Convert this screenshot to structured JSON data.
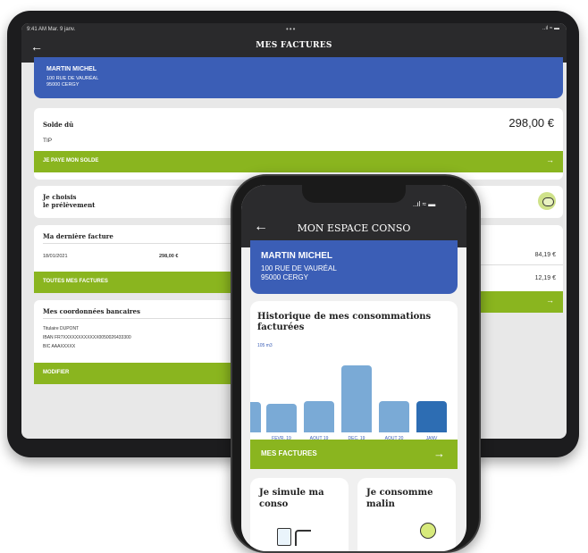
{
  "tablet": {
    "status_time": "9:41 AM  Mar. 9 janv.",
    "status_right": "..ıl ≈ ▬",
    "title": "MES FACTURES",
    "user": {
      "name": "MARTIN MICHEL",
      "address1": "100 RUE DE VAURÉAL",
      "address2": "95000 CERGY"
    },
    "balance": {
      "label": "Solde dû",
      "amount": "298,00 €",
      "mode": "TIP",
      "pay_button": "JE PAYE MON SOLDE"
    },
    "direct_debit": {
      "line1": "Je choisis",
      "line2": "le prélèvement"
    },
    "last_invoice": {
      "label": "Ma dernière facture",
      "date": "18/01/2021",
      "amount": "298,00 €",
      "all_button": "TOUTES MES FACTURES"
    },
    "right_amounts": [
      "84,19 €",
      "12,19 €"
    ],
    "bank": {
      "label": "Mes coordonnées bancaires",
      "holder_label": "Titulaire",
      "holder": "DUPONT",
      "iban_label": "IBAN",
      "iban": "FR7XXXXXXXXXXXX0050026433300",
      "bic_label": "BIC",
      "bic": "AAAXXXXX",
      "modify_button": "MODIFIER"
    }
  },
  "phone": {
    "status": "..ıl ≈ ▬",
    "title": "MON ESPACE CONSO",
    "user": {
      "name": "MARTIN MICHEL",
      "address1": "100 RUE DE VAURÉAL",
      "address2": "95000 CERGY"
    },
    "history_title": "Historique de mes consommations facturées",
    "invoices_button": "MES FACTURES",
    "tile1": "Je simule ma conso",
    "tile2": "Je consomme malin"
  },
  "chart_data": {
    "type": "bar",
    "title": "Historique de mes consommations facturées",
    "unit_label": "105 m3",
    "categories": [
      "",
      "FEVR. 19",
      "AOUT 19",
      "DEC. 19",
      "AOUT 20",
      "JANV"
    ],
    "values": [
      40,
      38,
      42,
      90,
      42,
      42
    ],
    "ylim": [
      0,
      105
    ],
    "colors": [
      "#7aaad6",
      "#7aaad6",
      "#7aaad6",
      "#7aaad6",
      "#7aaad6",
      "#2d6db3"
    ]
  },
  "colors": {
    "blue": "#3b5eb6",
    "green": "#8ab51f",
    "dark": "#2b2b2d"
  }
}
